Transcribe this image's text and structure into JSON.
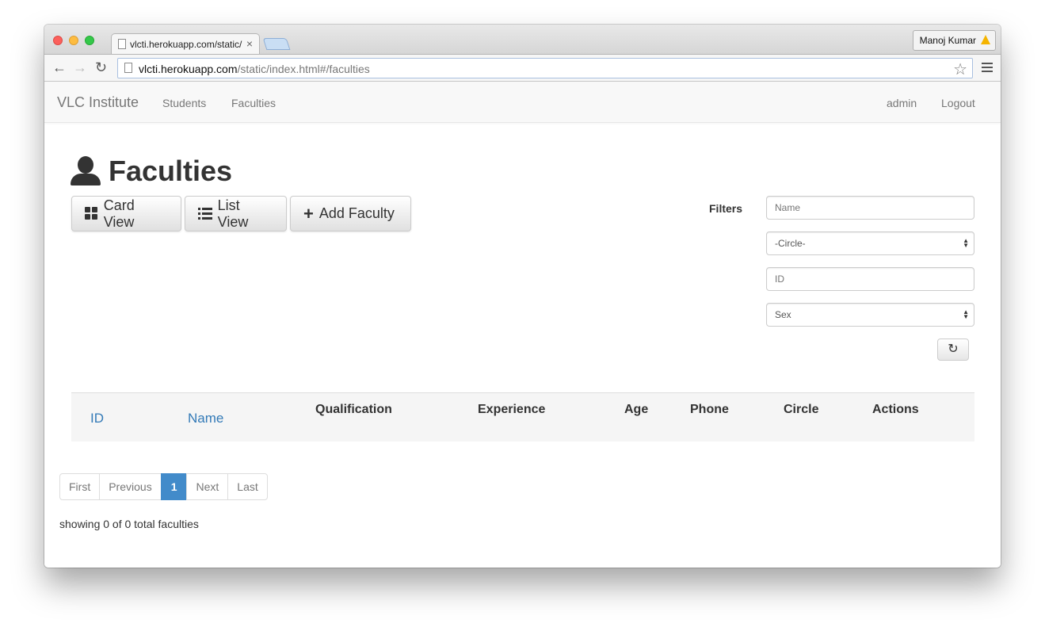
{
  "browser": {
    "tab_title": "vlcti.herokuapp.com/static/",
    "tab_close": "×",
    "profile_name": "Manoj Kumar",
    "url_host": "vlcti.herokuapp.com",
    "url_path": "/static/index.html#/faculties",
    "icons": [
      "back-icon",
      "forward-icon",
      "reload-icon",
      "bookmark-star-icon",
      "menu-icon",
      "warning-icon"
    ]
  },
  "navbar": {
    "brand": "VLC Institute",
    "links": [
      "Students",
      "Faculties"
    ],
    "user": "admin",
    "logout": "Logout"
  },
  "page": {
    "title": "Faculties",
    "buttons": {
      "card_view": "Card View",
      "list_view": "List View",
      "add_faculty": "Add Faculty"
    }
  },
  "filters": {
    "label": "Filters",
    "name_placeholder": "Name",
    "circle_selected": "-Circle-",
    "id_placeholder": "ID",
    "sex_selected": "Sex"
  },
  "table": {
    "columns": [
      "ID",
      "Name",
      "Qualification",
      "Experience",
      "Age",
      "Phone",
      "Circle",
      "Actions"
    ],
    "rows": []
  },
  "pagination": {
    "first": "First",
    "previous": "Previous",
    "current": "1",
    "next": "Next",
    "last": "Last"
  },
  "summary": "showing 0 of 0 total faculties",
  "colors": {
    "link": "#337ab7",
    "active_page": "#428bca"
  }
}
